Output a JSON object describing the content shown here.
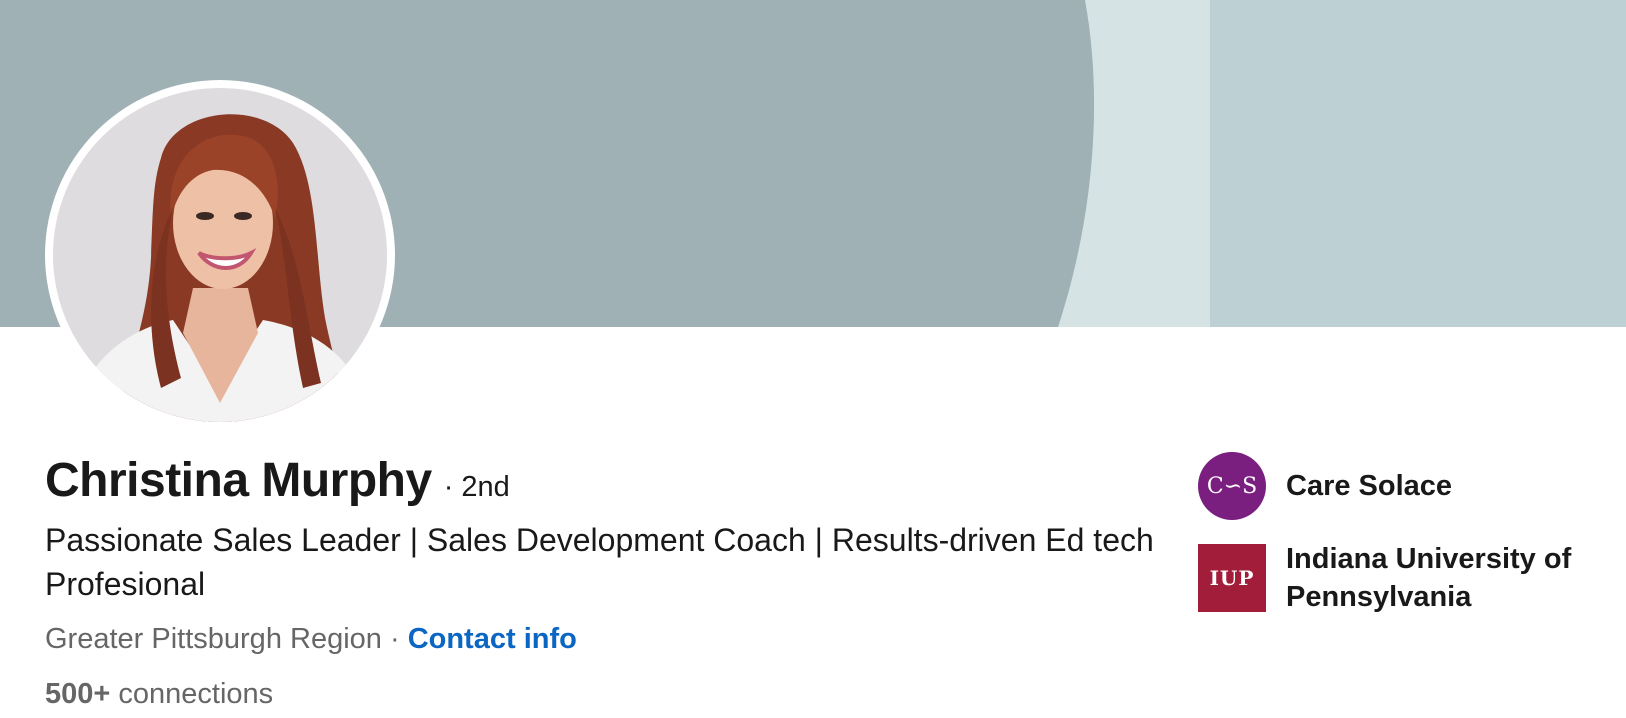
{
  "profile": {
    "name": "Christina Murphy",
    "degree": "· 2nd",
    "headline": "Passionate Sales Leader | Sales Development Coach | Results-driven Ed tech Profesional",
    "location": "Greater Pittsburgh Region",
    "separator": " · ",
    "contact_label": "Contact info",
    "connections_count": "500+",
    "connections_label": " connections"
  },
  "organizations": [
    {
      "name": "Care Solace",
      "logo_text": "C∽S",
      "logo_icon": "care-solace-logo",
      "logo_color": "#7a1f80"
    },
    {
      "name": "Indiana University of Pennsylvania",
      "logo_text": "IUP",
      "logo_icon": "iup-logo",
      "logo_color": "#a11d3a"
    }
  ],
  "colors": {
    "banner_dark": "#9fb1b5",
    "banner_light": "#d5e3e5",
    "banner_right": "#bdd1d5",
    "link": "#0a66c2",
    "muted_text": "#666666"
  }
}
